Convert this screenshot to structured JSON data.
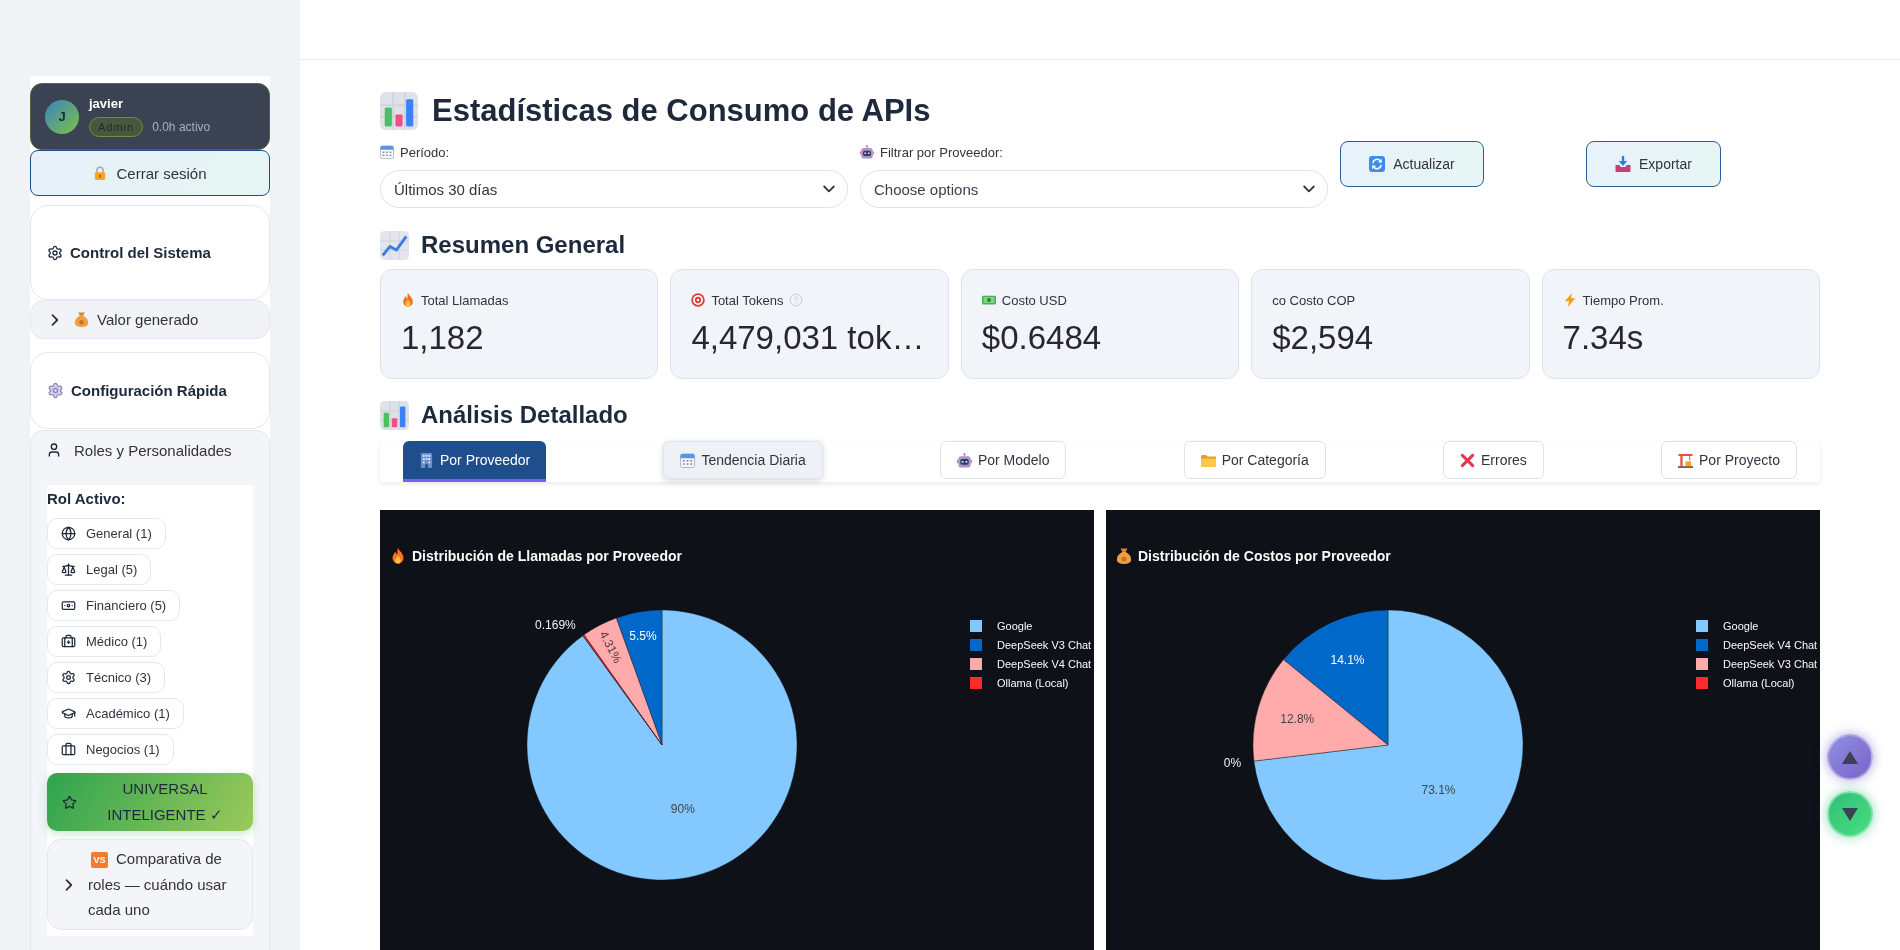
{
  "sidebar": {
    "user": {
      "initial": "J",
      "name": "javier",
      "role": "Admin",
      "activity": "0.0h activo"
    },
    "logout": {
      "label": "Cerrar sesión"
    },
    "system_control": {
      "title": "Control del Sistema"
    },
    "value_expander": {
      "title": "Valor generado",
      "expanded": false
    },
    "quick_config": {
      "title": "Configuración Rápida"
    },
    "roles": {
      "title": "Roles y Personalidades",
      "expanded": true,
      "active_label": "Rol Activo:",
      "items": [
        {
          "label": "General (1)",
          "selected": false
        },
        {
          "label": "Legal (5)",
          "selected": false
        },
        {
          "label": "Financiero (5)",
          "selected": false
        },
        {
          "label": "Médico (1)",
          "selected": false
        },
        {
          "label": "Técnico (3)",
          "selected": false
        },
        {
          "label": "Académico (1)",
          "selected": false
        },
        {
          "label": "Negocios (1)",
          "selected": false
        }
      ],
      "universal": {
        "label": "UNIVERSAL INTELIGENTE ✓",
        "selected": true
      },
      "comparison": {
        "badge": "VS",
        "title": "Comparativa de roles — cuándo usar cada uno",
        "expanded": false
      }
    }
  },
  "page_title": "Estadísticas de Consumo de APIs",
  "filters": [
    {
      "label": "Período:",
      "value": "Últimos 30 días"
    },
    {
      "label": "Filtrar por Proveedor:",
      "placeholder": "Choose options"
    }
  ],
  "actions": [
    {
      "label": "Actualizar"
    },
    {
      "label": "Exportar"
    }
  ],
  "summary": {
    "heading": "Resumen General",
    "metrics": [
      {
        "label": "Total Llamadas",
        "value": "1,182",
        "help": false
      },
      {
        "label": "Total Tokens",
        "value": "4,479,031 tok…",
        "help": true
      },
      {
        "label": "Costo USD",
        "value": "$0.6484",
        "help": false
      },
      {
        "label": "co Costo COP",
        "value": "$2,594",
        "help": false
      },
      {
        "label": "Tiempo Prom.",
        "value": "7.34s",
        "help": false
      }
    ]
  },
  "analysis": {
    "heading": "Análisis Detallado",
    "tabs": [
      {
        "label": "Por Proveedor",
        "selected": true,
        "hovered": false
      },
      {
        "label": "Tendencia Diaria",
        "selected": false,
        "hovered": true
      },
      {
        "label": "Por Modelo",
        "selected": false,
        "hovered": false
      },
      {
        "label": "Por Categoría",
        "selected": false,
        "hovered": false
      },
      {
        "label": "Errores",
        "selected": false,
        "hovered": false
      },
      {
        "label": "Por Proyecto",
        "selected": false,
        "hovered": false
      }
    ]
  },
  "charts": [
    {
      "chart_data": {
        "type": "pie",
        "title": "Distribución de Llamadas por Proveedor",
        "legend": "right",
        "categories": [
          "Google",
          "DeepSeek V3 Chat",
          "DeepSeek V4 Chat",
          "Ollama (Local)"
        ],
        "values": [
          90,
          5.5,
          4.31,
          0.169
        ],
        "colors": [
          "#83c9ff",
          "#0068c9",
          "#ffabab",
          "#ff2b2b"
        ],
        "value_labels": [
          "90%",
          "5.5%",
          "4.31%",
          "0.169%"
        ]
      }
    },
    {
      "chart_data": {
        "type": "pie",
        "title": "Distribución de Costos por Proveedor",
        "legend": "right",
        "categories": [
          "Google",
          "DeepSeek V4 Chat",
          "DeepSeek V3 Chat",
          "Ollama (Local)"
        ],
        "values": [
          73.1,
          14.1,
          12.8,
          0
        ],
        "colors": [
          "#83c9ff",
          "#0068c9",
          "#ffabab",
          "#ff2b2b"
        ],
        "value_labels": [
          "73.1%",
          "14.1%",
          "12.8%",
          "0%"
        ]
      }
    }
  ]
}
